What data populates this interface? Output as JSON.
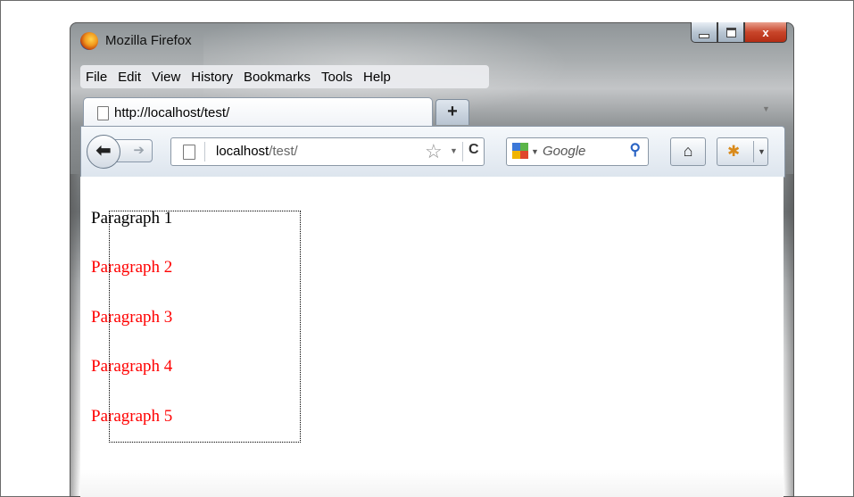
{
  "window": {
    "title": "Mozilla Firefox",
    "close_glyph": "x"
  },
  "menu": [
    "File",
    "Edit",
    "View",
    "History",
    "Bookmarks",
    "Tools",
    "Help"
  ],
  "tab": {
    "label": "http://localhost/test/",
    "new_tab_glyph": "+"
  },
  "nav": {
    "url_host": "localhost",
    "url_path": "/test/",
    "search_placeholder": "Google"
  },
  "page": {
    "paragraphs": [
      "Paragraph 1",
      "Paragraph 2",
      "Paragraph 3",
      "Paragraph 4",
      "Paragraph 5"
    ],
    "colors": {
      "first": "#000000",
      "rest": "#ff0000"
    }
  },
  "icons": {
    "firefox": "firefox-logo",
    "back": "back-arrow",
    "forward": "forward-arrow",
    "bookmark": "star",
    "reload": "reload",
    "search_engine": "google-logo",
    "search": "magnifier",
    "home": "house",
    "addon": "addon-bug"
  }
}
